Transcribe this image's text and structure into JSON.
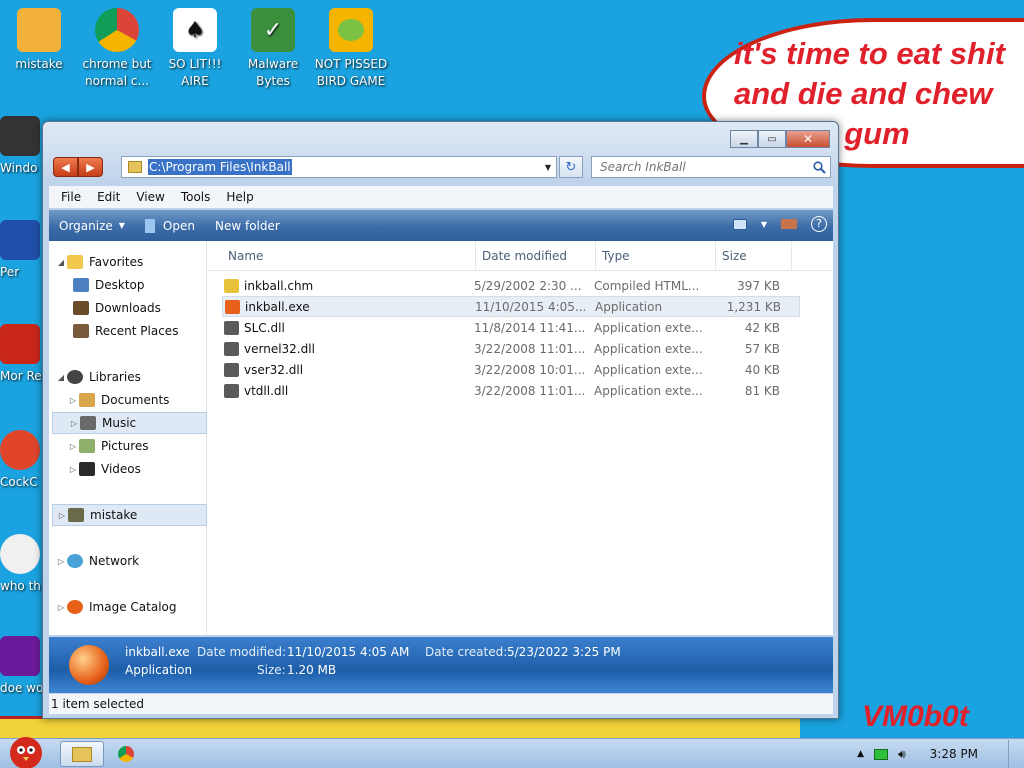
{
  "desktop": {
    "icons_top": [
      {
        "label": "mistake",
        "color": "#f2b13a",
        "icon": "computer-icon"
      },
      {
        "label": "chrome but normal c...",
        "color": "#db4437",
        "icon": "chrome-icon"
      },
      {
        "label": "SO LIT!!! AIRE",
        "color": "#2f6f3a",
        "icon": "solitaire-icon"
      },
      {
        "label": "Malware Bytes",
        "color": "#3b8f3d",
        "icon": "shield-icon"
      },
      {
        "label": "NOT PISSED BIRD GAME",
        "color": "#f4b400",
        "icon": "pig-icon"
      }
    ],
    "icons_left": [
      {
        "label": "Windo Vis",
        "color": "#333333"
      },
      {
        "label": "Per",
        "color": "#1f4fa8"
      },
      {
        "label": "Mor Rea",
        "color": "#c9261a"
      },
      {
        "label": "CockC",
        "color": "#e0452a"
      },
      {
        "label": "who th uses",
        "color": "#f0f0f0"
      },
      {
        "label": "doe work",
        "color": "#6a1a9a"
      }
    ],
    "bubble_lines": [
      "it's time to eat shit",
      "and die and chew",
      "bubble gum"
    ],
    "watermark": "VM0b0t"
  },
  "window": {
    "address_path": "C:\\Program Files\\InkBall",
    "search_placeholder": "Search InkBall",
    "menu": [
      "File",
      "Edit",
      "View",
      "Tools",
      "Help"
    ],
    "toolbar": {
      "organize": "Organize",
      "open": "Open",
      "new_folder": "New folder"
    },
    "nav": {
      "favorites": "Favorites",
      "desktop": "Desktop",
      "downloads": "Downloads",
      "recent_places": "Recent Places",
      "libraries": "Libraries",
      "documents": "Documents",
      "music": "Music",
      "pictures": "Pictures",
      "videos": "Videos",
      "mistake": "mistake",
      "network": "Network",
      "image_catalog": "Image Catalog"
    },
    "columns": {
      "name": "Name",
      "date": "Date modified",
      "type": "Type",
      "size": "Size"
    },
    "files": [
      {
        "name": "inkball.chm",
        "date": "5/29/2002 2:30 ...",
        "type": "Compiled HTML...",
        "size": "397 KB",
        "color": "#e8c23a"
      },
      {
        "name": "inkball.exe",
        "date": "11/10/2015 4:05...",
        "type": "Application",
        "size": "1,231 KB",
        "color": "#e8611a"
      },
      {
        "name": "SLC.dll",
        "date": "11/8/2014 11:41...",
        "type": "Application exte...",
        "size": "42 KB",
        "color": "#5a5a5a"
      },
      {
        "name": "vernel32.dll",
        "date": "3/22/2008 11:01...",
        "type": "Application exte...",
        "size": "57 KB",
        "color": "#5a5a5a"
      },
      {
        "name": "vser32.dll",
        "date": "3/22/2008 10:01...",
        "type": "Application exte...",
        "size": "40 KB",
        "color": "#5a5a5a"
      },
      {
        "name": "vtdll.dll",
        "date": "3/22/2008 11:01...",
        "type": "Application exte...",
        "size": "81 KB",
        "color": "#5a5a5a"
      }
    ],
    "details": {
      "name": "inkball.exe",
      "kind": "Application",
      "date_modified_label": "Date modified:",
      "date_modified": "11/10/2015 4:05 AM",
      "size_label": "Size:",
      "size": "1.20 MB",
      "date_created_label": "Date created:",
      "date_created": "5/23/2022 3:25 PM"
    },
    "status": "1 item selected"
  },
  "taskbar": {
    "clock": "3:28 PM"
  }
}
